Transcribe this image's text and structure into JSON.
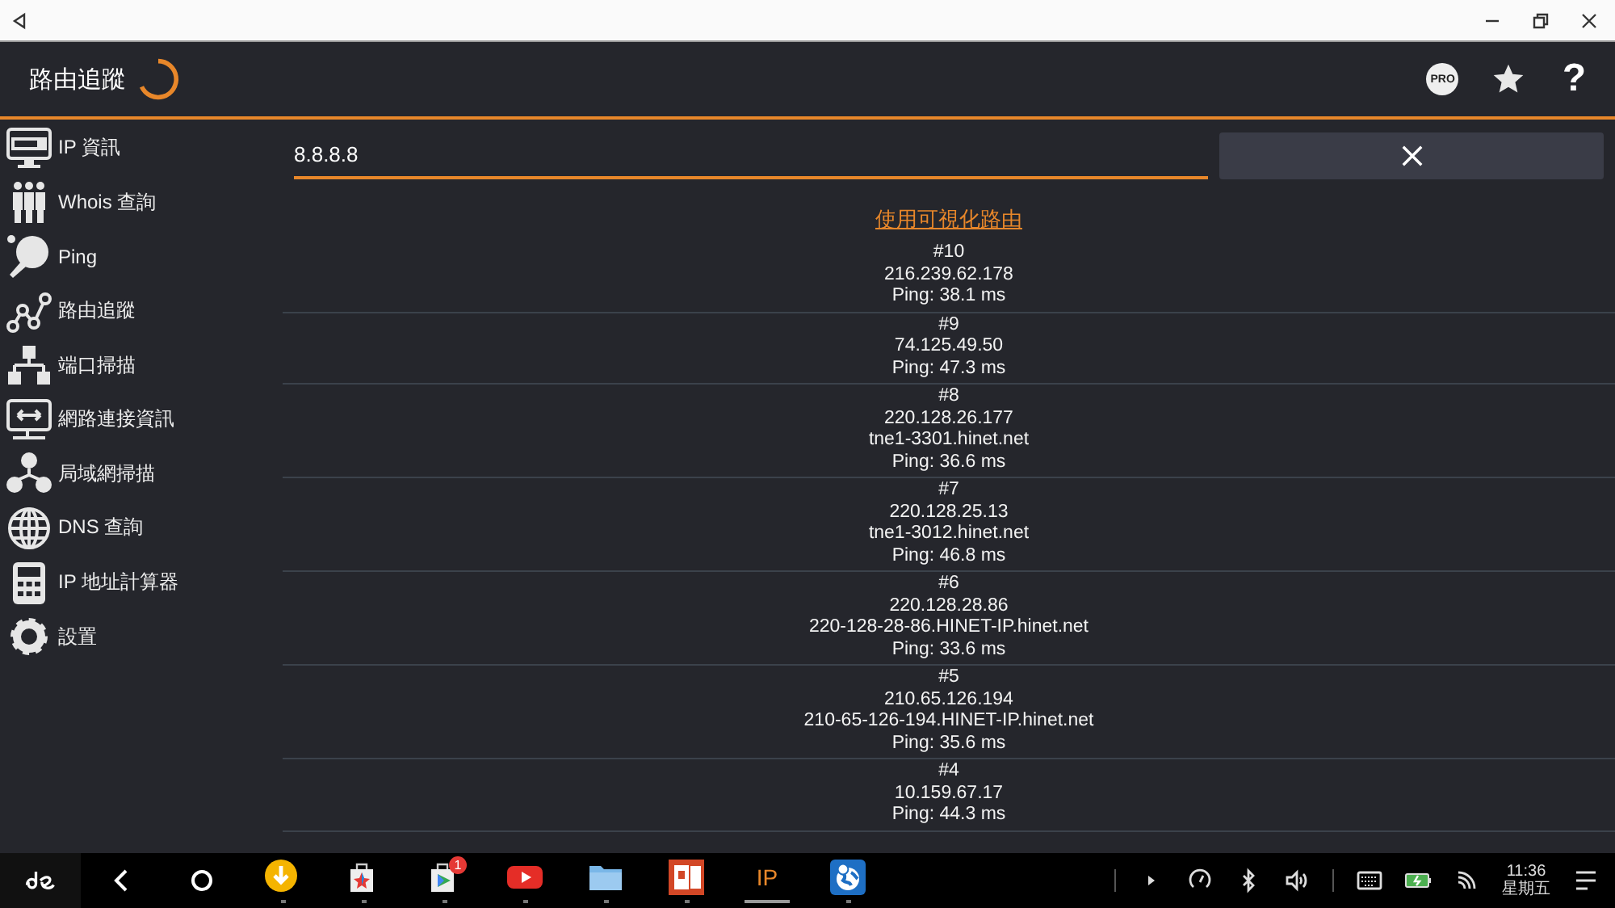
{
  "app_bar": {
    "title": "路由追蹤",
    "actions": [
      {
        "kind": "pro",
        "label": "PRO"
      },
      {
        "kind": "star"
      },
      {
        "kind": "help",
        "label": "?"
      }
    ]
  },
  "sidebar": {
    "items": [
      {
        "label": "IP 資訊"
      },
      {
        "label": "Whois 查詢"
      },
      {
        "label": "Ping"
      },
      {
        "label": "路由追蹤"
      },
      {
        "label": "端口掃描"
      },
      {
        "label": "網路連接資訊"
      },
      {
        "label": "局域網掃描"
      },
      {
        "label": "DNS 查詢"
      },
      {
        "label": "IP 地址計算器"
      },
      {
        "label": "設置"
      }
    ]
  },
  "search": {
    "value": "8.8.8.8"
  },
  "visual_route_link": "使用可視化路由",
  "hops": [
    {
      "number": "#10",
      "lines": [
        "216.239.62.178",
        "Ping: 38.1 ms"
      ]
    },
    {
      "number": "#9",
      "lines": [
        "74.125.49.50",
        "Ping: 47.3 ms"
      ]
    },
    {
      "number": "#8",
      "lines": [
        "220.128.26.177",
        "tne1-3301.hinet.net",
        "Ping: 36.6 ms"
      ]
    },
    {
      "number": "#7",
      "lines": [
        "220.128.25.13",
        "tne1-3012.hinet.net",
        "Ping: 46.8 ms"
      ]
    },
    {
      "number": "#6",
      "lines": [
        "220.128.28.86",
        "220-128-28-86.HINET-IP.hinet.net",
        "Ping: 33.6 ms"
      ]
    },
    {
      "number": "#5",
      "lines": [
        "210.65.126.194",
        "210-65-126-194.HINET-IP.hinet.net",
        "Ping: 35.6 ms"
      ]
    },
    {
      "number": "#4",
      "lines": [
        "10.159.67.17",
        "Ping: 44.3 ms"
      ]
    }
  ],
  "taskbar": {
    "apps": [
      {
        "selected": false
      },
      {
        "selected": false
      },
      {
        "selected": false,
        "badge": "1"
      },
      {
        "selected": false
      },
      {
        "selected": false
      },
      {
        "selected": false
      },
      {
        "selected": true,
        "label": "IP"
      },
      {
        "selected": false
      }
    ],
    "clock": {
      "time": "11:36",
      "day": "星期五"
    }
  }
}
